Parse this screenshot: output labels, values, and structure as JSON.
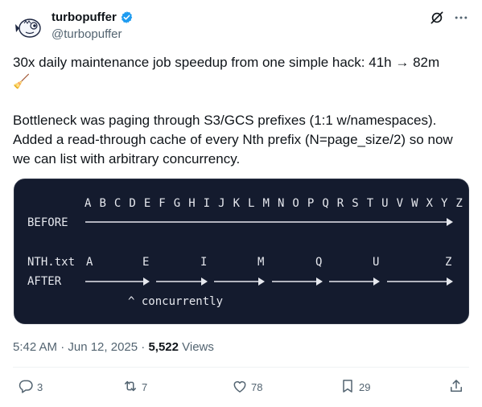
{
  "author": {
    "display_name": "turbopuffer",
    "handle": "@turbopuffer"
  },
  "icons": {
    "verified": "verified-badge-icon",
    "grok": "grok-icon",
    "more": "more-icon",
    "reply": "reply-icon",
    "retweet": "retweet-icon",
    "like": "like-icon",
    "bookmark": "bookmark-icon",
    "share": "share-icon"
  },
  "colors": {
    "verified": "#1d9bf0",
    "code_bg": "#141b2e",
    "muted": "#536471"
  },
  "tweet": {
    "line1": "30x daily maintenance job speedup from one simple hack: 41h → 82m",
    "emoji": "🧹",
    "para2_line1": "Bottleneck was paging through S3/GCS prefixes (1:1 w/namespaces).",
    "para2_line2": "Added a read-through cache of every Nth prefix (N=page_size/2) so now",
    "para2_line3": "we can list with arbitrary concurrency."
  },
  "code": {
    "alphabet": "A B C D E F G H I J K L M N O P Q R S T U V W X Y Z",
    "before_label": "BEFORE",
    "nth_label": "NTH.txt",
    "nth_letters": [
      "A",
      "E",
      "I",
      "M",
      "Q",
      "U",
      "Z"
    ],
    "after_label": "AFTER",
    "caption": "^ concurrently"
  },
  "meta": {
    "time": "5:42 AM · Jun 12, 2025 · ",
    "views_count": "5,522",
    "views_label": " Views"
  },
  "actions": {
    "replies": "3",
    "retweets": "7",
    "likes": "78",
    "bookmarks": "29"
  }
}
